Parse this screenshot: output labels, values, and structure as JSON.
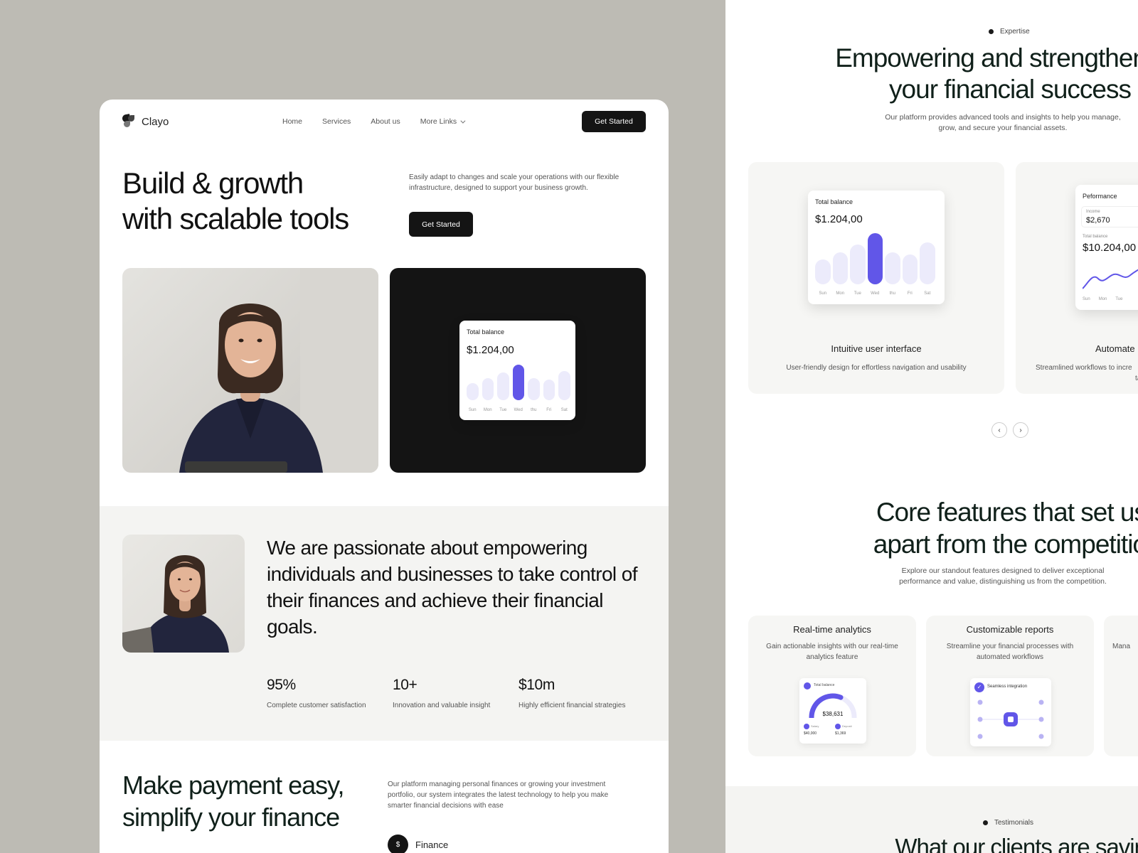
{
  "left": {
    "brand": "Clayo",
    "nav": [
      "Home",
      "Services",
      "About us",
      "More Links"
    ],
    "nav_cta": "Get Started",
    "hero_title_l1": "Build & growth",
    "hero_title_l2": "with scalable tools",
    "hero_desc": "Easily adapt to changes and scale your operations with our flexible infrastructure, designed to support your business growth.",
    "hero_cta": "Get Started",
    "balance_card": {
      "label": "Total balance",
      "value": "$1.204,00",
      "days": [
        "Sun",
        "Mon",
        "Tue",
        "Wed",
        "thu",
        "Fri",
        "Sat"
      ],
      "levels": [
        0.48,
        0.62,
        0.78,
        1.0,
        0.62,
        0.58,
        0.82
      ],
      "active_index": 3
    },
    "about_text": "We are passionate about empowering individuals and businesses to take control of their finances and achieve their financial goals.",
    "stats": [
      {
        "value": "95%",
        "label": "Complete customer satisfaction"
      },
      {
        "value": "10+",
        "label": "Innovation and valuable insight"
      },
      {
        "value": "$10m",
        "label": "Highly efficient financial strategies"
      }
    ],
    "pay_title_l1": "Make payment easy,",
    "pay_title_l2": "simplify your finance",
    "pay_desc": "Our platform managing personal finances or growing your investment portfolio, our system integrates the latest technology to help you make smarter financial decisions with ease",
    "finance_label": "Finance",
    "finance_icon": "$"
  },
  "right": {
    "tag": "Expertise",
    "title_l1": "Empowering and strengthen",
    "title_l2": "your financial success",
    "desc": "Our platform provides advanced tools and insights to help you manage, grow, and secure your financial assets.",
    "card1": {
      "title": "Intuitive user interface",
      "desc": "User-friendly design for effortless navigation and usability",
      "widget_label": "Total balance",
      "widget_value": "$1.204,00",
      "days": [
        "Sun",
        "Mon",
        "Tue",
        "Wed",
        "thu",
        "Fri",
        "Sat"
      ]
    },
    "card2": {
      "title": "Automate",
      "desc": "Streamlined workflows to incre",
      "desc2": "ta",
      "widget_label": "Peformance",
      "income_label": "Income",
      "income_value": "$2,670",
      "total_label": "Total balance",
      "total_value": "$10.204,00",
      "days": [
        "Sun",
        "Mon",
        "Tue"
      ]
    },
    "pager_prev": "‹",
    "pager_next": "›",
    "core_title_l1": "Core features that set us",
    "core_title_l2": "apart from the competitio",
    "core_desc": "Explore our standout features designed to deliver exceptional performance and value, distinguishing us from the competition.",
    "core_cards": [
      {
        "title": "Real-time analytics",
        "desc": "Gain actionable insights with our real-time analytics feature",
        "widget_label": "Total balance",
        "widget_value": "$38,631",
        "a_label": "Salary",
        "a_value": "$40,000",
        "b_label": "Deposit",
        "b_value": "$1,369",
        "gauge_level": 0.62
      },
      {
        "title": "Customizable reports",
        "desc": "Streamline your financial processes with automated workflows",
        "widget_label": "Seamless integration"
      },
      {
        "title": "",
        "desc": "Mana"
      }
    ],
    "testimonial_tag": "Testimonials",
    "testimonial_title": "What our clients are savin"
  },
  "colors": {
    "accent": "#6156e8",
    "accent_light": "#ecebfb",
    "dark": "#141414",
    "backdrop": "#bdbbb4",
    "band": "#f4f4f2"
  },
  "icons": [
    "logo-mark-icon",
    "chevron-down-icon",
    "dollar-icon",
    "arrow-left-icon",
    "arrow-right-icon",
    "check-icon"
  ]
}
